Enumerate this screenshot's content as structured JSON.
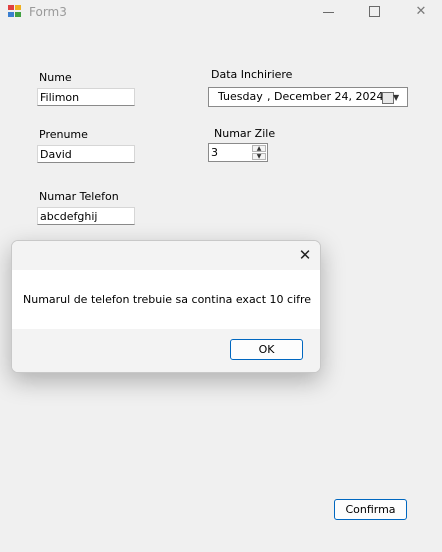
{
  "window": {
    "title": "Form3",
    "minimize_glyph": "",
    "maximize_glyph": "",
    "close_glyph": "✕"
  },
  "form": {
    "nume_label": "Nume",
    "nume_value": "Filimon",
    "prenume_label": "Prenume",
    "prenume_value": "David",
    "telefon_label": "Numar Telefon",
    "telefon_value": "abcdefghij",
    "data_label": "Data Inchiriere",
    "date_dow": "Tuesday",
    "date_rest": ", December 24, 2024",
    "zile_label": "Numar Zile",
    "zile_value": "3",
    "confirm_label": "Confirma"
  },
  "dialog": {
    "message": "Numarul de telefon trebuie sa contina exact 10 cifre",
    "ok_label": "OK",
    "close_glyph": "✕"
  },
  "icons": {
    "app": "form-icon",
    "calendar": "calendar-icon",
    "dropdown": "chevron-down-icon"
  },
  "colors": {
    "accent_border": "#0067c0",
    "background": "#f0f0f0",
    "title_text": "#9a9a9a"
  }
}
